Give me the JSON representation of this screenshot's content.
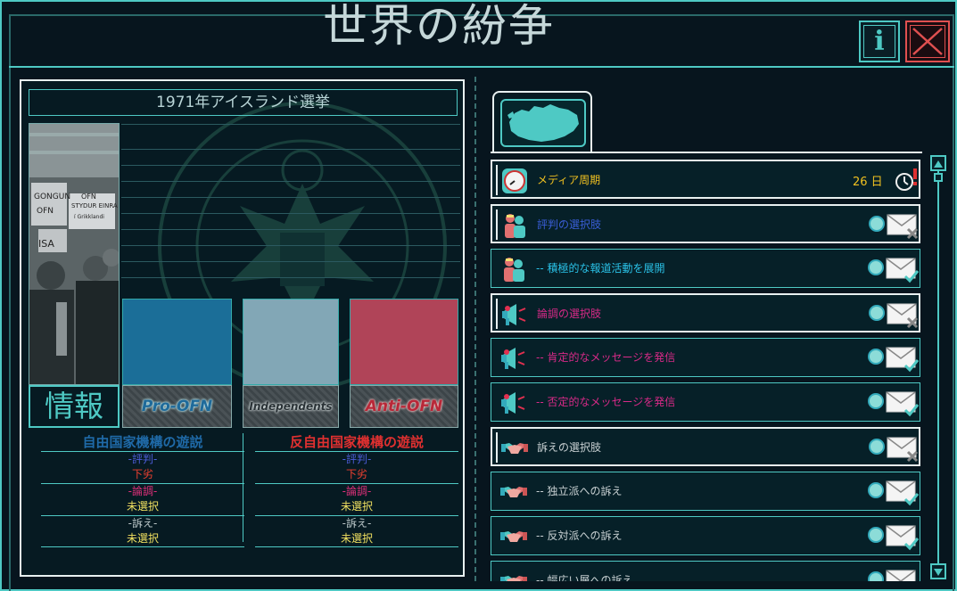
{
  "title": "世界の紛争",
  "buttons": {
    "info": "i"
  },
  "election": {
    "title": "1971年アイスランド選挙"
  },
  "info_tab": "情報",
  "factions": [
    {
      "key": "pro",
      "label": "Pro-OFN",
      "color": "#1b6e98"
    },
    {
      "key": "ind",
      "label": "Independents",
      "color": "#82a7b6"
    },
    {
      "key": "anti",
      "label": "Anti-OFN",
      "color": "#b04458"
    }
  ],
  "photo_signs": [
    "GONGUN",
    "OFN",
    "STYDUR EINRA",
    "í Grikklandi",
    "ISA",
    "OFN"
  ],
  "campaigns": {
    "left": {
      "title": "自由国家機構の遊説",
      "items": [
        {
          "label": "-評判-",
          "value": "下劣"
        },
        {
          "label": "-論調-",
          "value": "未選択"
        },
        {
          "label": "-訴え-",
          "value": "未選択"
        }
      ]
    },
    "right": {
      "title": "反自由国家機構の遊説",
      "items": [
        {
          "label": "-評判-",
          "value": "下劣"
        },
        {
          "label": "-論調-",
          "value": "未選択"
        },
        {
          "label": "-訴え-",
          "value": "未選択"
        }
      ]
    }
  },
  "media": {
    "label": "メディア周期",
    "days": "26 日"
  },
  "rows": [
    {
      "label": "評判の選択肢",
      "kind": "header",
      "color": "blue",
      "icon": "people-icon",
      "status": "unavailable"
    },
    {
      "label": "-- 積極的な報道活動を展開",
      "kind": "option",
      "color": "cyan",
      "icon": "people-icon",
      "status": "available"
    },
    {
      "label": "論調の選択肢",
      "kind": "header",
      "color": "pink",
      "icon": "megaphone-icon",
      "status": "unavailable"
    },
    {
      "label": "-- 肯定的なメッセージを発信",
      "kind": "option",
      "color": "pink",
      "icon": "megaphone-icon",
      "status": "available"
    },
    {
      "label": "-- 否定的なメッセージを発信",
      "kind": "option",
      "color": "pink",
      "icon": "megaphone-icon",
      "status": "available"
    },
    {
      "label": "訴えの選択肢",
      "kind": "header",
      "color": "grey",
      "icon": "handshake-icon",
      "status": "unavailable"
    },
    {
      "label": "-- 独立派への訴え",
      "kind": "option",
      "color": "grey",
      "icon": "handshake-icon",
      "status": "available"
    },
    {
      "label": "-- 反対派への訴え",
      "kind": "option",
      "color": "grey",
      "icon": "handshake-icon",
      "status": "available"
    },
    {
      "label": "-- 幅広い層への訴え",
      "kind": "option",
      "color": "grey",
      "icon": "handshake-icon",
      "status": "available"
    }
  ],
  "colors": {
    "accent": "#4ec9c4",
    "close": "#e05050"
  }
}
